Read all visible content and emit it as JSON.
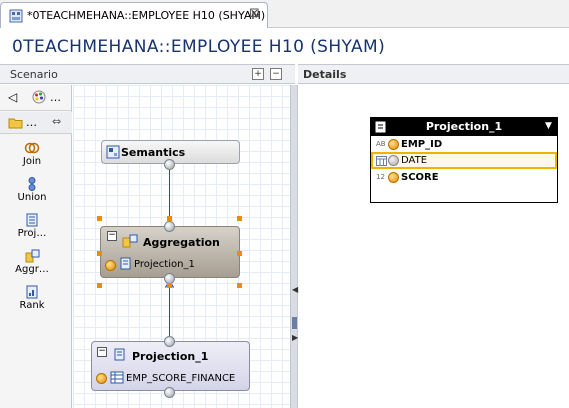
{
  "tab": {
    "label": "*0TEACHMEHANA::EMPLOYEE H10 (SHYAM)",
    "close_glyph": "⊠"
  },
  "page_title": "0TEACHMEHANA::EMPLOYEE H10 (SHYAM)",
  "scenario": {
    "label": "Scenario",
    "palette_items": [
      {
        "label": "Join",
        "icon": "join-icon"
      },
      {
        "label": "Union",
        "icon": "union-icon"
      },
      {
        "label": "Proj…",
        "icon": "projection-icon"
      },
      {
        "label": "Aggr…",
        "icon": "aggregation-icon"
      },
      {
        "label": "Rank",
        "icon": "rank-icon"
      }
    ],
    "palette_more": "…"
  },
  "nodes": {
    "semantics": {
      "title": "Semantics"
    },
    "aggregation": {
      "title": "Aggregation",
      "input": "Projection_1"
    },
    "projection": {
      "title": "Projection_1",
      "input": "EMP_SCORE_FINANCE"
    }
  },
  "details": {
    "label": "Details",
    "table": {
      "title": "Projection_1",
      "columns": [
        {
          "type": "AB",
          "name": "EMP_ID",
          "bold": true,
          "selected": false
        },
        {
          "type": "",
          "name": "DATE",
          "bold": false,
          "selected": true
        },
        {
          "type": "12",
          "name": "SCORE",
          "bold": true,
          "selected": false
        }
      ]
    }
  },
  "colors": {
    "title": "#17346f",
    "accent_orange": "#f08a00",
    "connector": "#3d3dc6"
  }
}
